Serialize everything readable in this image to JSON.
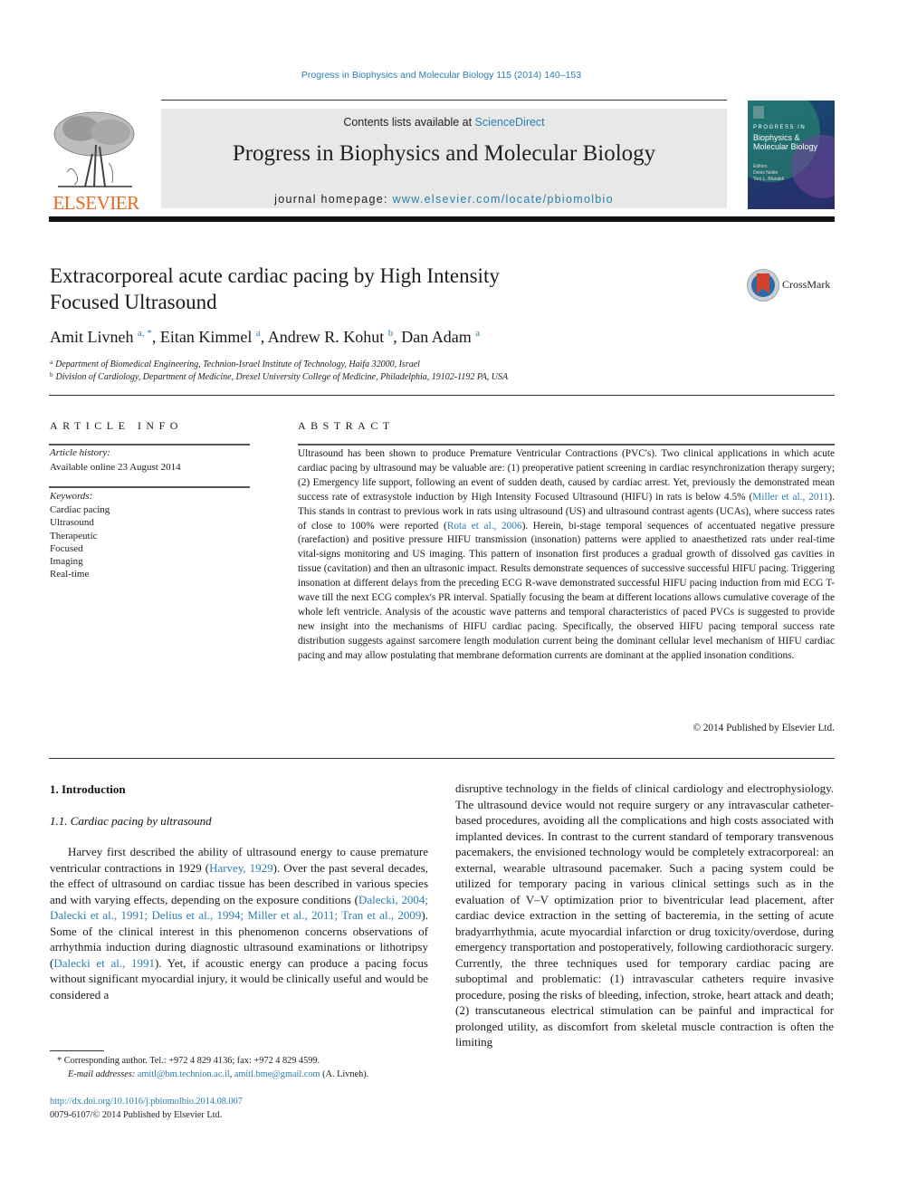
{
  "citation_line": "Progress in Biophysics and Molecular Biology 115 (2014) 140–153",
  "header": {
    "publisher_logo_text": "ELSEVIER",
    "contents_prefix": "Contents lists available at ",
    "contents_link": "ScienceDirect",
    "journal_title": "Progress in Biophysics and Molecular Biology",
    "homepage_prefix": "journal homepage: ",
    "homepage_link": "www.elsevier.com/locate/pbiomolbio",
    "cover": {
      "series_label": "PROGRESS IN",
      "title": "Biophysics & Molecular Biology",
      "editors_label": "Editors",
      "editors": [
        "Denis Noble",
        "Tom L. Blundell"
      ]
    }
  },
  "crossmark_label": "CrossMark",
  "article": {
    "title_line1": "Extracorporeal acute cardiac pacing by High Intensity",
    "title_line2": "Focused Ultrasound",
    "authors": [
      {
        "name": "Amit Livneh",
        "sup": "a, *",
        "sep": ", "
      },
      {
        "name": "Eitan Kimmel",
        "sup": "a",
        "sep": ", "
      },
      {
        "name": "Andrew R. Kohut",
        "sup": "b",
        "sep": ", "
      },
      {
        "name": "Dan Adam",
        "sup": "a",
        "sep": ""
      }
    ],
    "affiliations": [
      {
        "mark": "a",
        "text": "Department of Biomedical Engineering, Technion-Israel Institute of Technology, Haifa 32000, Israel"
      },
      {
        "mark": "b",
        "text": "Division of Cardiology, Department of Medicine, Drexel University College of Medicine, Philadelphia, 19102-1192 PA, USA"
      }
    ]
  },
  "article_info": {
    "heading": "ARTICLE INFO",
    "history_label": "Article history:",
    "history_value": "Available online 23 August 2014",
    "keywords_label": "Keywords:",
    "keywords": [
      "Cardiac pacing",
      "Ultrasound",
      "Therapeutic",
      "Focused",
      "Imaging",
      "Real-time"
    ]
  },
  "abstract": {
    "heading": "ABSTRACT",
    "part1": "Ultrasound has been shown to produce Premature Ventricular Contractions (PVC's). Two clinical applications in which acute cardiac pacing by ultrasound may be valuable are: (1) preoperative patient screening in cardiac resynchronization therapy surgery; (2) Emergency life support, following an event of sudden death, caused by cardiac arrest. Yet, previously the demonstrated mean success rate of extrasystole induction by High Intensity Focused Ultrasound (HIFU) in rats is below 4.5% (",
    "ref1": "Miller et al., 2011",
    "part2": "). This stands in contrast to previous work in rats using ultrasound (US) and ultrasound contrast agents (UCAs), where success rates of close to 100% were reported (",
    "ref2": "Rota et al., 2006",
    "part3": "). Herein, bi-stage temporal sequences of accentuated negative pressure (rarefaction) and positive pressure HIFU transmission (insonation) patterns were applied to anaesthetized rats under real-time vital-signs monitoring and US imaging. This pattern of insonation first produces a gradual growth of dissolved gas cavities in tissue (cavitation) and then an ultrasonic impact. Results demonstrate sequences of successive successful HIFU pacing. Triggering insonation at different delays from the preceding ECG R-wave demonstrated successful HIFU pacing induction from mid ECG T-wave till the next ECG complex's PR interval. Spatially focusing the beam at different locations allows cumulative coverage of the whole left ventricle. Analysis of the acoustic wave patterns and temporal characteristics of paced PVCs is suggested to provide new insight into the mechanisms of HIFU cardiac pacing. Specifically, the observed HIFU pacing temporal success rate distribution suggests against sarcomere length modulation current being the dominant cellular level mechanism of HIFU cardiac pacing and may allow postulating that membrane deformation currents are dominant at the applied insonation conditions.",
    "copyright": "© 2014 Published by Elsevier Ltd."
  },
  "body": {
    "section_heading": "1.  Introduction",
    "subsection_heading": "1.1.  Cardiac pacing by ultrasound",
    "left": {
      "p1": "Harvey first described the ability of ultrasound energy to cause premature ventricular contractions in 1929 (",
      "ref1": "Harvey, 1929",
      "p2": "). Over the past several decades, the effect of ultrasound on cardiac tissue has been described in various species and with varying effects, depending on the exposure conditions (",
      "ref2": "Dalecki, 2004; Dalecki et al., 1991; Delius et al., 1994; Miller et al., 2011; Tran et al., 2009",
      "p3": "). Some of the clinical interest in this phenomenon concerns observations of arrhythmia induction during diagnostic ultrasound examinations or lithotripsy (",
      "ref3": "Dalecki et al., 1991",
      "p4": "). Yet, if acoustic energy can produce a pacing focus without significant myocardial injury, it would be clinically useful and would be considered a"
    },
    "right": "disruptive technology in the fields of clinical cardiology and electrophysiology. The ultrasound device would not require surgery or any intravascular catheter-based procedures, avoiding all the complications and high costs associated with implanted devices. In contrast to the current standard of temporary transvenous pacemakers, the envisioned technology would be completely extracorporeal: an external, wearable ultrasound pacemaker. Such a pacing system could be utilized for temporary pacing in various clinical settings such as in the evaluation of V–V optimization prior to biventricular lead placement, after cardiac device extraction in the setting of bacteremia, in the setting of acute bradyarrhythmia, acute myocardial infarction or drug toxicity/overdose, during emergency transportation and postoperatively, following cardiothoracic surgery. Currently, the three techniques used for temporary cardiac pacing are suboptimal and problematic: (1) intravascular catheters require invasive procedure, posing the risks of bleeding, infection, stroke, heart attack and death; (2) transcutaneous electrical stimulation can be painful and impractical for prolonged utility, as discomfort from skeletal muscle contraction is often the limiting"
  },
  "footnotes": {
    "corresponding": "* Corresponding author. Tel.: +972 4 829 4136; fax: +972 4 829 4599.",
    "email_label": "E-mail addresses: ",
    "email1": "amitl@bm.technion.ac.il",
    "email_sep": ", ",
    "email2": "amitl.bme@gmail.com",
    "email_suffix": " (A. Livneh).",
    "doi": "http://dx.doi.org/10.1016/j.pbiomolbio.2014.08.007",
    "issn": "0079-6107/© 2014 Published by Elsevier Ltd."
  },
  "colors": {
    "link": "#2a7fb0",
    "elsevier_orange": "#e8691f",
    "header_box": "#e8e8e8"
  }
}
